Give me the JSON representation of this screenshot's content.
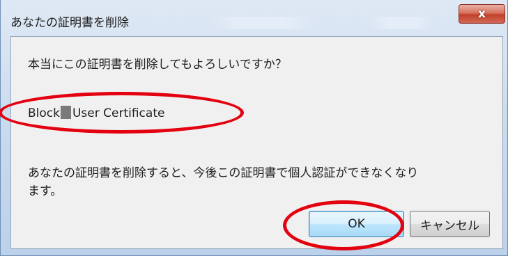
{
  "dialog": {
    "title": "あなたの証明書を削除",
    "close_label": "x",
    "question": "本当にこの証明書を削除してもよろしいですか？",
    "cert_name_prefix": "Block",
    "cert_name_suffix": "User Certificate",
    "warning_line1": "あなたの証明書を削除すると、今後この証明書で個人認証ができなくなり",
    "warning_line2": "ます。",
    "ok_label": "OK",
    "cancel_label": "キャンセル"
  },
  "colors": {
    "highlight": "#e3000f",
    "close_button": "#c2402a"
  }
}
